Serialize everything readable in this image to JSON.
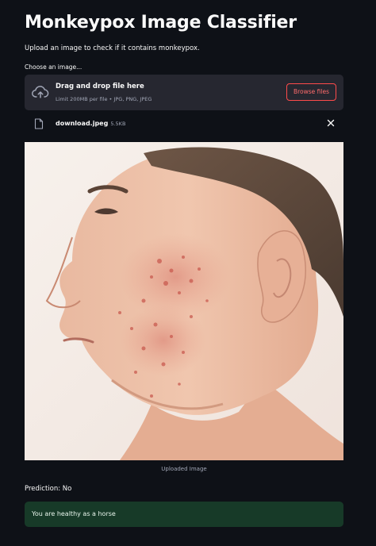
{
  "app": {
    "title": "Monkeypox Image Classifier",
    "subtitle": "Upload an image to check if it contains monkeypox."
  },
  "uploader": {
    "label": "Choose an image...",
    "drop_title": "Drag and drop file here",
    "limit_text": "Limit 200MB per file • JPG, PNG, JPEG",
    "browse_label": "Browse files",
    "upload_icon": "cloud-upload-icon"
  },
  "file": {
    "name": "download.jpeg",
    "size": "5.5KB",
    "file_icon": "file-icon",
    "remove_icon": "close-icon"
  },
  "image": {
    "caption": "Uploaded Image"
  },
  "result": {
    "prediction": "Prediction: No",
    "message": "You are healthy as a horse"
  },
  "colors": {
    "background": "#0e1117",
    "panel": "#262730",
    "accent": "#ff4b4b",
    "success_bg": "#173a28"
  }
}
